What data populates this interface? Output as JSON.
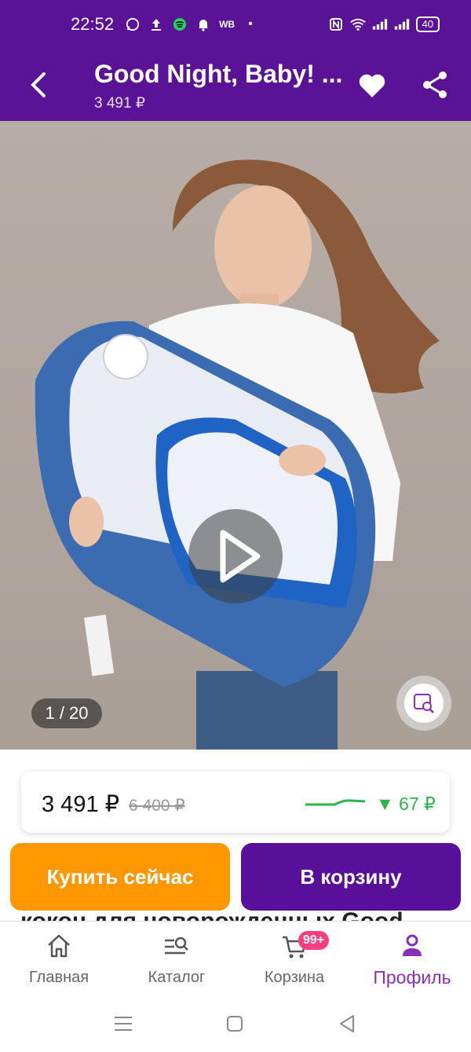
{
  "status_bar": {
    "time": "22:52",
    "carrier_badge": "WB",
    "battery": "40"
  },
  "header": {
    "title": "Good Night, Baby! ...",
    "subtitle": "3 491 ₽"
  },
  "gallery": {
    "counter": "1 / 20"
  },
  "price": {
    "current": "3 491 ₽",
    "old": "6 400 ₽",
    "drop": "▼ 67 ₽"
  },
  "actions": {
    "buy_now": "Купить сейчас",
    "add_to_cart": "В корзину"
  },
  "peek": {
    "text": "кокон для новорожденных Good"
  },
  "bottom_nav": {
    "items": [
      {
        "label": "Главная",
        "icon": "home-icon"
      },
      {
        "label": "Каталог",
        "icon": "catalog-search-icon"
      },
      {
        "label": "Корзина",
        "icon": "cart-icon",
        "badge": "99+"
      },
      {
        "label": "Профиль",
        "icon": "profile-icon"
      }
    ]
  },
  "colors": {
    "brand": "#5a1396",
    "accent_orange": "#ff9800",
    "badge": "#ff3d7f",
    "price_drop": "#2db34a"
  }
}
